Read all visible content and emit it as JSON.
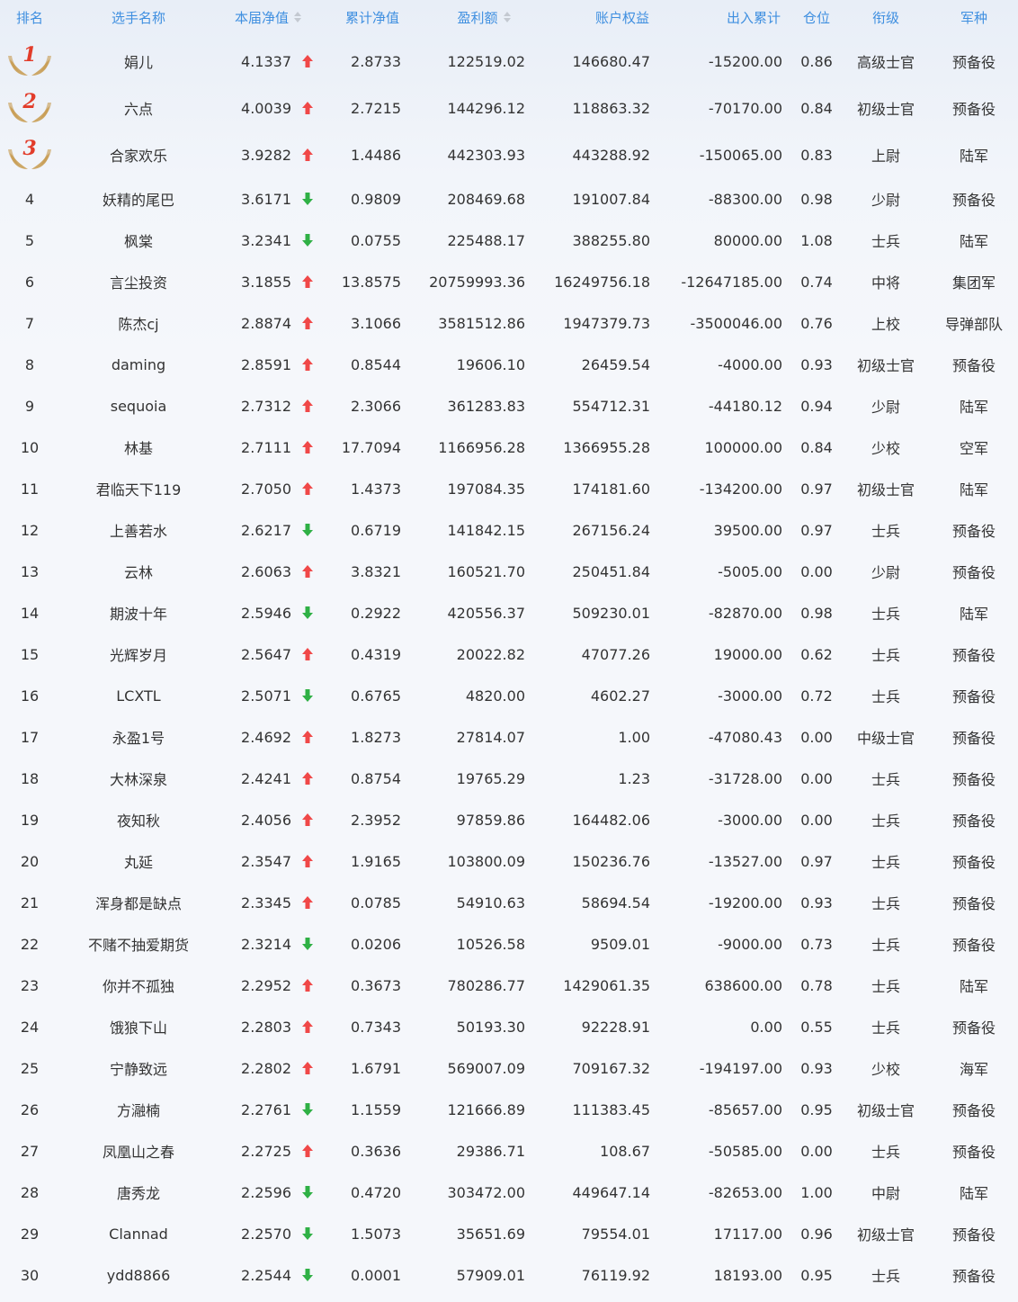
{
  "header": {
    "rank": "排名",
    "name": "选手名称",
    "nav": "本届净值",
    "cum_nav": "累计净值",
    "profit": "盈利额",
    "equity": "账户权益",
    "flow": "出入累计",
    "position": "仓位",
    "title_rank": "衔级",
    "branch": "军种"
  },
  "colors": {
    "header_text": "#3f8fe0",
    "up_arrow": "#f04848",
    "down_arrow": "#2fb045",
    "medal_number": "#e23c2a",
    "wing": "#c79a4e"
  },
  "rows": [
    {
      "rank": "1",
      "name": "娟儿",
      "nav": "4.1337",
      "trend": "up",
      "cum": "2.8733",
      "profit": "122519.02",
      "equity": "146680.47",
      "flow": "-15200.00",
      "pos": "0.86",
      "title": "高级士官",
      "branch": "预备役"
    },
    {
      "rank": "2",
      "name": "六点",
      "nav": "4.0039",
      "trend": "up",
      "cum": "2.7215",
      "profit": "144296.12",
      "equity": "118863.32",
      "flow": "-70170.00",
      "pos": "0.84",
      "title": "初级士官",
      "branch": "预备役"
    },
    {
      "rank": "3",
      "name": "合家欢乐",
      "nav": "3.9282",
      "trend": "up",
      "cum": "1.4486",
      "profit": "442303.93",
      "equity": "443288.92",
      "flow": "-150065.00",
      "pos": "0.83",
      "title": "上尉",
      "branch": "陆军"
    },
    {
      "rank": "4",
      "name": "妖精的尾巴",
      "nav": "3.6171",
      "trend": "down",
      "cum": "0.9809",
      "profit": "208469.68",
      "equity": "191007.84",
      "flow": "-88300.00",
      "pos": "0.98",
      "title": "少尉",
      "branch": "预备役"
    },
    {
      "rank": "5",
      "name": "枫棠",
      "nav": "3.2341",
      "trend": "down",
      "cum": "0.0755",
      "profit": "225488.17",
      "equity": "388255.80",
      "flow": "80000.00",
      "pos": "1.08",
      "title": "士兵",
      "branch": "陆军"
    },
    {
      "rank": "6",
      "name": "言尘投资",
      "nav": "3.1855",
      "trend": "up",
      "cum": "13.8575",
      "profit": "20759993.36",
      "equity": "16249756.18",
      "flow": "-12647185.00",
      "pos": "0.74",
      "title": "中将",
      "branch": "集团军"
    },
    {
      "rank": "7",
      "name": "陈杰cj",
      "nav": "2.8874",
      "trend": "up",
      "cum": "3.1066",
      "profit": "3581512.86",
      "equity": "1947379.73",
      "flow": "-3500046.00",
      "pos": "0.76",
      "title": "上校",
      "branch": "导弹部队"
    },
    {
      "rank": "8",
      "name": "daming",
      "nav": "2.8591",
      "trend": "up",
      "cum": "0.8544",
      "profit": "19606.10",
      "equity": "26459.54",
      "flow": "-4000.00",
      "pos": "0.93",
      "title": "初级士官",
      "branch": "预备役"
    },
    {
      "rank": "9",
      "name": "sequoia",
      "nav": "2.7312",
      "trend": "up",
      "cum": "2.3066",
      "profit": "361283.83",
      "equity": "554712.31",
      "flow": "-44180.12",
      "pos": "0.94",
      "title": "少尉",
      "branch": "陆军"
    },
    {
      "rank": "10",
      "name": "林基",
      "nav": "2.7111",
      "trend": "up",
      "cum": "17.7094",
      "profit": "1166956.28",
      "equity": "1366955.28",
      "flow": "100000.00",
      "pos": "0.84",
      "title": "少校",
      "branch": "空军"
    },
    {
      "rank": "11",
      "name": "君临天下119",
      "nav": "2.7050",
      "trend": "up",
      "cum": "1.4373",
      "profit": "197084.35",
      "equity": "174181.60",
      "flow": "-134200.00",
      "pos": "0.97",
      "title": "初级士官",
      "branch": "陆军"
    },
    {
      "rank": "12",
      "name": "上善若水",
      "nav": "2.6217",
      "trend": "down",
      "cum": "0.6719",
      "profit": "141842.15",
      "equity": "267156.24",
      "flow": "39500.00",
      "pos": "0.97",
      "title": "士兵",
      "branch": "预备役"
    },
    {
      "rank": "13",
      "name": "云林",
      "nav": "2.6063",
      "trend": "up",
      "cum": "3.8321",
      "profit": "160521.70",
      "equity": "250451.84",
      "flow": "-5005.00",
      "pos": "0.00",
      "title": "少尉",
      "branch": "预备役"
    },
    {
      "rank": "14",
      "name": "期波十年",
      "nav": "2.5946",
      "trend": "down",
      "cum": "0.2922",
      "profit": "420556.37",
      "equity": "509230.01",
      "flow": "-82870.00",
      "pos": "0.98",
      "title": "士兵",
      "branch": "陆军"
    },
    {
      "rank": "15",
      "name": "光辉岁月",
      "nav": "2.5647",
      "trend": "up",
      "cum": "0.4319",
      "profit": "20022.82",
      "equity": "47077.26",
      "flow": "19000.00",
      "pos": "0.62",
      "title": "士兵",
      "branch": "预备役"
    },
    {
      "rank": "16",
      "name": "LCXTL",
      "nav": "2.5071",
      "trend": "down",
      "cum": "0.6765",
      "profit": "4820.00",
      "equity": "4602.27",
      "flow": "-3000.00",
      "pos": "0.72",
      "title": "士兵",
      "branch": "预备役"
    },
    {
      "rank": "17",
      "name": "永盈1号",
      "nav": "2.4692",
      "trend": "up",
      "cum": "1.8273",
      "profit": "27814.07",
      "equity": "1.00",
      "flow": "-47080.43",
      "pos": "0.00",
      "title": "中级士官",
      "branch": "预备役"
    },
    {
      "rank": "18",
      "name": "大林深泉",
      "nav": "2.4241",
      "trend": "up",
      "cum": "0.8754",
      "profit": "19765.29",
      "equity": "1.23",
      "flow": "-31728.00",
      "pos": "0.00",
      "title": "士兵",
      "branch": "预备役"
    },
    {
      "rank": "19",
      "name": "夜知秋",
      "nav": "2.4056",
      "trend": "up",
      "cum": "2.3952",
      "profit": "97859.86",
      "equity": "164482.06",
      "flow": "-3000.00",
      "pos": "0.00",
      "title": "士兵",
      "branch": "预备役"
    },
    {
      "rank": "20",
      "name": "丸延",
      "nav": "2.3547",
      "trend": "up",
      "cum": "1.9165",
      "profit": "103800.09",
      "equity": "150236.76",
      "flow": "-13527.00",
      "pos": "0.97",
      "title": "士兵",
      "branch": "预备役"
    },
    {
      "rank": "21",
      "name": "浑身都是缺点",
      "nav": "2.3345",
      "trend": "up",
      "cum": "0.0785",
      "profit": "54910.63",
      "equity": "58694.54",
      "flow": "-19200.00",
      "pos": "0.93",
      "title": "士兵",
      "branch": "预备役"
    },
    {
      "rank": "22",
      "name": "不赌不抽爱期货",
      "nav": "2.3214",
      "trend": "down",
      "cum": "0.0206",
      "profit": "10526.58",
      "equity": "9509.01",
      "flow": "-9000.00",
      "pos": "0.73",
      "title": "士兵",
      "branch": "预备役"
    },
    {
      "rank": "23",
      "name": "你并不孤独",
      "nav": "2.2952",
      "trend": "up",
      "cum": "0.3673",
      "profit": "780286.77",
      "equity": "1429061.35",
      "flow": "638600.00",
      "pos": "0.78",
      "title": "士兵",
      "branch": "陆军"
    },
    {
      "rank": "24",
      "name": "饿狼下山",
      "nav": "2.2803",
      "trend": "up",
      "cum": "0.7343",
      "profit": "50193.30",
      "equity": "92228.91",
      "flow": "0.00",
      "pos": "0.55",
      "title": "士兵",
      "branch": "预备役"
    },
    {
      "rank": "25",
      "name": "宁静致远",
      "nav": "2.2802",
      "trend": "up",
      "cum": "1.6791",
      "profit": "569007.09",
      "equity": "709167.32",
      "flow": "-194197.00",
      "pos": "0.93",
      "title": "少校",
      "branch": "海军"
    },
    {
      "rank": "26",
      "name": "方瀜楠",
      "nav": "2.2761",
      "trend": "down",
      "cum": "1.1559",
      "profit": "121666.89",
      "equity": "111383.45",
      "flow": "-85657.00",
      "pos": "0.95",
      "title": "初级士官",
      "branch": "预备役"
    },
    {
      "rank": "27",
      "name": "凤凰山之春",
      "nav": "2.2725",
      "trend": "up",
      "cum": "0.3636",
      "profit": "29386.71",
      "equity": "108.67",
      "flow": "-50585.00",
      "pos": "0.00",
      "title": "士兵",
      "branch": "预备役"
    },
    {
      "rank": "28",
      "name": "唐秀龙",
      "nav": "2.2596",
      "trend": "down",
      "cum": "0.4720",
      "profit": "303472.00",
      "equity": "449647.14",
      "flow": "-82653.00",
      "pos": "1.00",
      "title": "中尉",
      "branch": "陆军"
    },
    {
      "rank": "29",
      "name": "Clannad",
      "nav": "2.2570",
      "trend": "down",
      "cum": "1.5073",
      "profit": "35651.69",
      "equity": "79554.01",
      "flow": "17117.00",
      "pos": "0.96",
      "title": "初级士官",
      "branch": "预备役"
    },
    {
      "rank": "30",
      "name": "ydd8866",
      "nav": "2.2544",
      "trend": "down",
      "cum": "0.0001",
      "profit": "57909.01",
      "equity": "76119.92",
      "flow": "18193.00",
      "pos": "0.95",
      "title": "士兵",
      "branch": "预备役"
    }
  ]
}
